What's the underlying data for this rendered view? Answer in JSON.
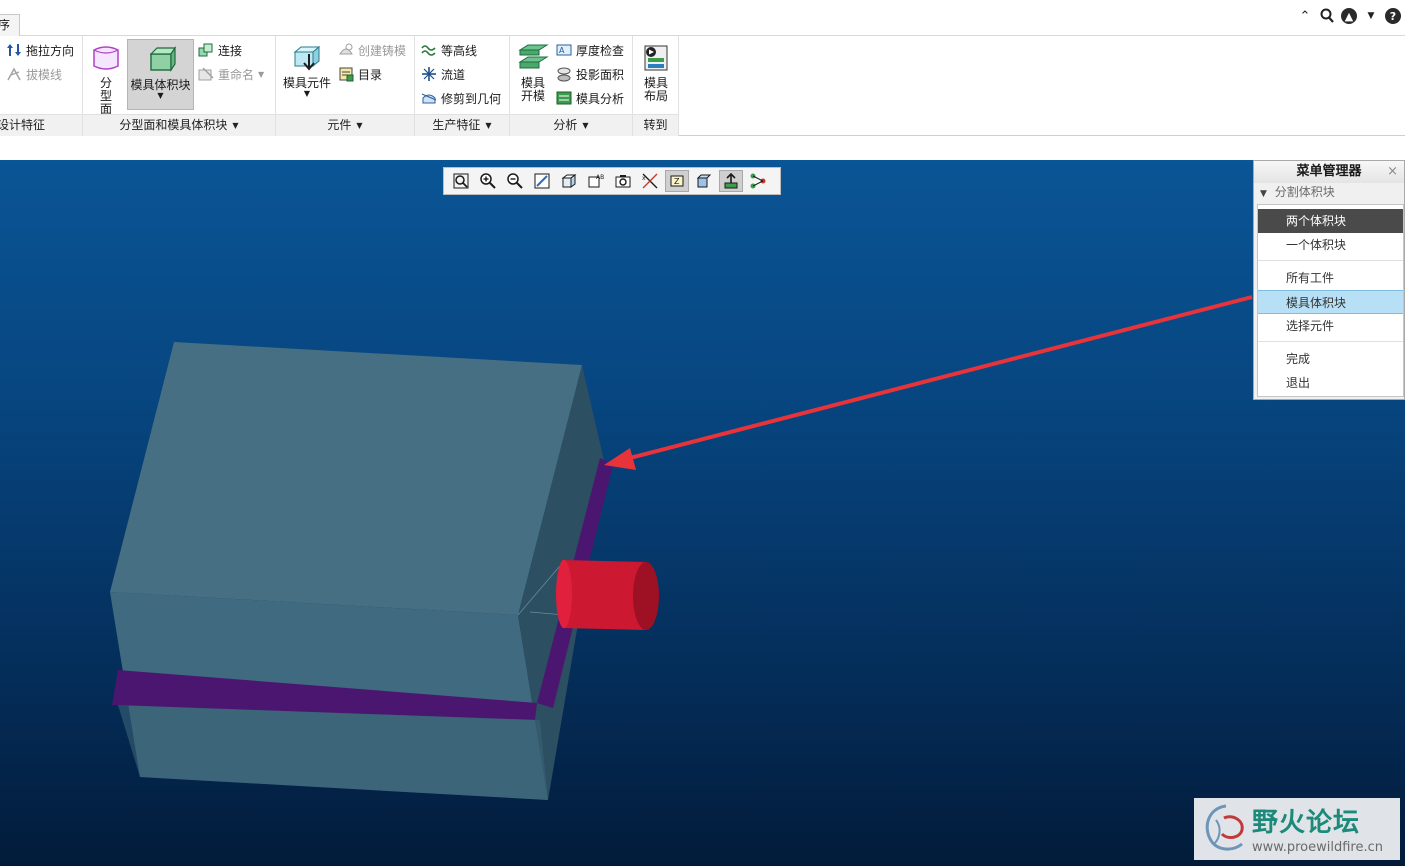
{
  "tabstrip": {
    "partial_tab": "序"
  },
  "ribbon": {
    "groups": {
      "design": {
        "label": "设计特征",
        "pull_direction": "拖拉方向",
        "draft_line": "拔模线"
      },
      "parting": {
        "label": "分型面和模具体积块",
        "parting_surface": "分型面",
        "mold_volume": "模具体积块",
        "connect": "连接",
        "rename": "重命名"
      },
      "component": {
        "label": "元件",
        "mold_component": "模具元件",
        "create_casting": "创建铸模",
        "catalog": "目录"
      },
      "production": {
        "label": "生产特征",
        "contour": "等高线",
        "runner": "流道",
        "trim_to_geometry": "修剪到几何"
      },
      "analysis": {
        "label": "分析",
        "mold_open": "模具开模",
        "thickness_check": "厚度检查",
        "projected_area": "投影面积",
        "mold_analysis": "模具分析"
      },
      "goto": {
        "label": "转到",
        "mold_layout": "模具布局"
      }
    }
  },
  "menu_manager": {
    "title": "菜单管理器",
    "close": "×",
    "section": "分割体积块",
    "items": [
      "两个体积块",
      "一个体积块",
      "所有工件",
      "模具体积块",
      "选择元件",
      "完成",
      "退出"
    ]
  },
  "watermark": {
    "title": "野火论坛",
    "url": "www.proewildfire.cn"
  },
  "colors": {
    "background_top": "#0a5596",
    "background_bottom": "#021b3a",
    "block": "#436c82",
    "parting_line": "#4a1670",
    "sprue": "#cc1830",
    "arrow": "#e8333a",
    "menu_highlight": "#b7e0f6"
  }
}
